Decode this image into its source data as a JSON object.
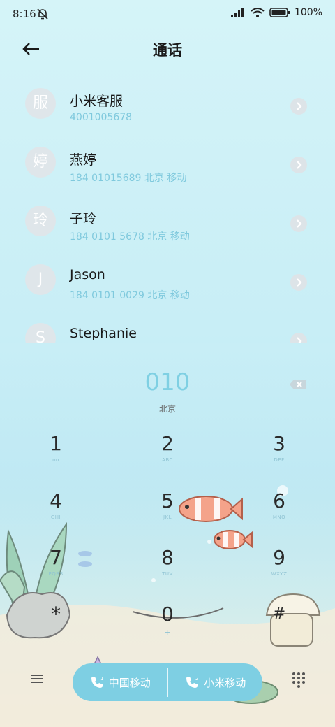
{
  "status_bar": {
    "time": "8:16",
    "battery": "100%"
  },
  "header": {
    "title": "通话"
  },
  "contacts": [
    {
      "avatar": "服",
      "name": "小米客服",
      "number": "4001005678"
    },
    {
      "avatar": "婷",
      "name": "燕婷",
      "number": "184 01015689  北京 移动"
    },
    {
      "avatar": "玲",
      "name": "子玲",
      "number": "184 0101 5678  北京 移动"
    },
    {
      "avatar": "J",
      "name": "Jason",
      "number": "184 0101 0029  北京 移动"
    },
    {
      "avatar": "S",
      "name": "Stephanie",
      "number": ""
    }
  ],
  "dialer": {
    "number": "010",
    "location": "北京",
    "keys": [
      {
        "digit": "1",
        "letters": "oo"
      },
      {
        "digit": "2",
        "letters": "ABC"
      },
      {
        "digit": "3",
        "letters": "DEF"
      },
      {
        "digit": "4",
        "letters": "GHI"
      },
      {
        "digit": "5",
        "letters": "JKL"
      },
      {
        "digit": "6",
        "letters": "MNO"
      },
      {
        "digit": "7",
        "letters": "PQRS"
      },
      {
        "digit": "8",
        "letters": "TUV"
      },
      {
        "digit": "9",
        "letters": "WXYZ"
      },
      {
        "digit": "*",
        "letters": ""
      },
      {
        "digit": "0",
        "letters": "+"
      },
      {
        "digit": "#",
        "letters": ""
      }
    ]
  },
  "call_buttons": {
    "sim1": {
      "label": "中国移动",
      "sim": "1"
    },
    "sim2": {
      "label": "小米移动",
      "sim": "2"
    }
  },
  "icons": {
    "back": "arrow-left-icon",
    "backspace": "backspace-icon",
    "menu": "menu-icon",
    "dialpad": "dialpad-icon",
    "phone": "phone-icon"
  },
  "colors": {
    "accent": "#7ecfe3",
    "sub_text": "#7fc9dd"
  }
}
